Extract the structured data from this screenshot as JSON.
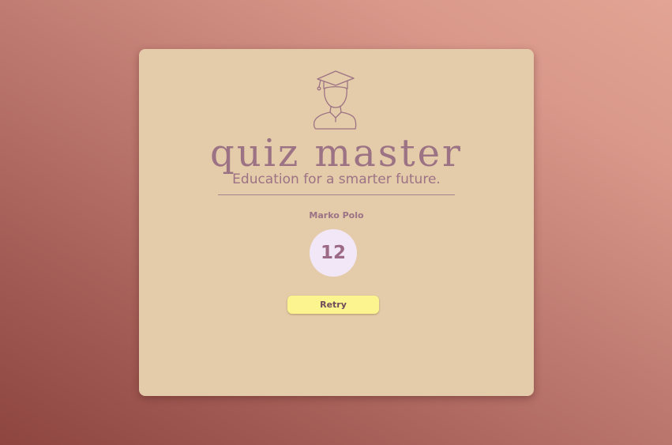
{
  "app": {
    "title": "quiz master",
    "tagline": "Education for a smarter future.",
    "logo_icon": "graduate-icon"
  },
  "result": {
    "player_name": "Marko Polo",
    "score": "12"
  },
  "actions": {
    "retry_label": "Retry"
  },
  "colors": {
    "card_background": "#e4cba9",
    "accent_text": "#9c7385",
    "score_circle": "#f2e7f7",
    "retry_button": "#fcf48f"
  }
}
